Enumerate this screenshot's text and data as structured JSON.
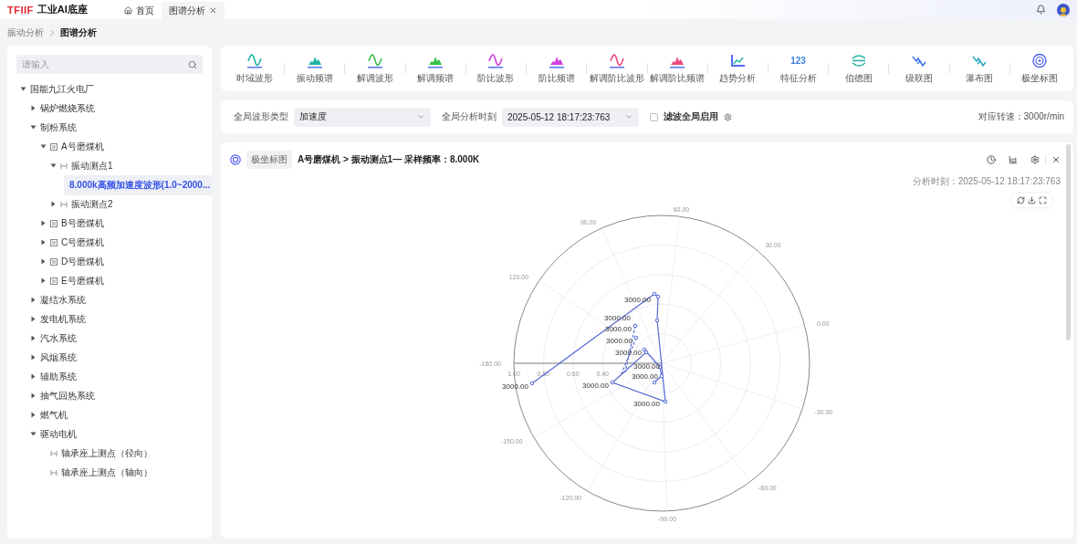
{
  "topbar": {
    "logo_mark": "TFIIF",
    "logo_text": "工业AI底座",
    "tabs": [
      {
        "label": "首页",
        "selected": false,
        "closable": false,
        "home": true
      },
      {
        "label": "图谱分析",
        "selected": true,
        "closable": true,
        "home": false
      }
    ]
  },
  "breadcrumb": [
    "振动分析",
    "图谱分析"
  ],
  "sidebar": {
    "search": {
      "placeholder": "请输入"
    },
    "tree": [
      {
        "label": "国能九江火电厂",
        "kind": "group",
        "expanded": true,
        "children": [
          {
            "label": "锅炉燃烧系统",
            "kind": "group",
            "expanded": false
          },
          {
            "label": "制粉系统",
            "kind": "group",
            "expanded": true,
            "children": [
              {
                "label": "A号磨煤机",
                "kind": "machine",
                "expanded": true,
                "children": [
                  {
                    "label": "振动测点1",
                    "kind": "point",
                    "expanded": true,
                    "children": [
                      {
                        "label": "8.000k高频加速度波形(1.0~2000...",
                        "kind": "channel",
                        "selected": true
                      }
                    ]
                  },
                  {
                    "label": "振动测点2",
                    "kind": "point",
                    "expanded": false
                  }
                ]
              },
              {
                "label": "B号磨煤机",
                "kind": "machine",
                "expanded": false
              },
              {
                "label": "C号磨煤机",
                "kind": "machine",
                "expanded": false
              },
              {
                "label": "D号磨煤机",
                "kind": "machine",
                "expanded": false
              },
              {
                "label": "E号磨煤机",
                "kind": "machine",
                "expanded": false
              }
            ]
          },
          {
            "label": "凝结水系统",
            "kind": "group",
            "expanded": false
          },
          {
            "label": "发电机系统",
            "kind": "group",
            "expanded": false
          },
          {
            "label": "汽水系统",
            "kind": "group",
            "expanded": false
          },
          {
            "label": "风烟系统",
            "kind": "group",
            "expanded": false
          },
          {
            "label": "辅助系统",
            "kind": "group",
            "expanded": false
          },
          {
            "label": "抽气回热系统",
            "kind": "group",
            "expanded": false
          },
          {
            "label": "燃气机",
            "kind": "group",
            "expanded": false
          },
          {
            "label": "驱动电机",
            "kind": "group",
            "expanded": true,
            "children": [
              {
                "label": "轴承座上测点（径向）",
                "kind": "point"
              },
              {
                "label": "轴承座上测点（轴向）",
                "kind": "point"
              }
            ]
          }
        ]
      }
    ]
  },
  "toolbar": [
    {
      "label": "时域波形",
      "kind": "wave",
      "color": "#22b3a6"
    },
    {
      "label": "振动频谱",
      "kind": "spectrum",
      "color": "#22b3a6"
    },
    {
      "label": "解调波形",
      "kind": "wave",
      "color": "#3cbf4a"
    },
    {
      "label": "解调频谱",
      "kind": "spectrum",
      "color": "#3cbf4a"
    },
    {
      "label": "阶比波形",
      "kind": "wave",
      "color": "#d23ee0"
    },
    {
      "label": "阶比频谱",
      "kind": "spectrum",
      "color": "#d23ee0"
    },
    {
      "label": "解调阶比波形",
      "kind": "wave",
      "color": "#ee4a7c"
    },
    {
      "label": "解调阶比频谱",
      "kind": "spectrum",
      "color": "#ee4a7c"
    },
    {
      "label": "趋势分析",
      "kind": "trend",
      "color": "#4f6df0"
    },
    {
      "label": "特征分析",
      "kind": "text",
      "color": "#3a7fd6",
      "icon_text": "123"
    },
    {
      "label": "伯德图",
      "kind": "bode",
      "color": "#22b3a6"
    },
    {
      "label": "级联图",
      "kind": "cascade",
      "color": "#3a6ee8"
    },
    {
      "label": "瀑布图",
      "kind": "cascade",
      "color": "#22a6c0"
    },
    {
      "label": "极坐标图",
      "kind": "polar",
      "color": "#4f5ff0"
    }
  ],
  "filters": {
    "wave_type_label": "全局波形类型",
    "wave_type": "加速度",
    "time_label": "全局分析时刻",
    "time": "2025-05-12 18:17:23:763",
    "filter_checkbox": {
      "label": "滤波全局启用",
      "checked": false
    },
    "speed": "对应转速：3000r/min"
  },
  "chart_card": {
    "tag": "极坐标图",
    "title": "A号磨煤机 > 振动测点1— 采样频率：8.000K",
    "analysis_time": "分析时刻：2025-05-12 18:17:23:763",
    "angle_labels": [
      "0.00",
      "30.00",
      "60.00",
      "90.00",
      "120.00",
      "-180.00",
      "-150.00",
      "-120.00",
      "-90.00",
      "-60.00",
      "-30.00"
    ],
    "radius_labels": [
      "1.00",
      "0.80",
      "0.60",
      "0.40"
    ],
    "point_labels": [
      "3000.00",
      "3000.00",
      "3000.00",
      "3000.00",
      "3000.00",
      "3000.00",
      "3000.00",
      "3000.00",
      "3000.00",
      "3000.00"
    ]
  }
}
